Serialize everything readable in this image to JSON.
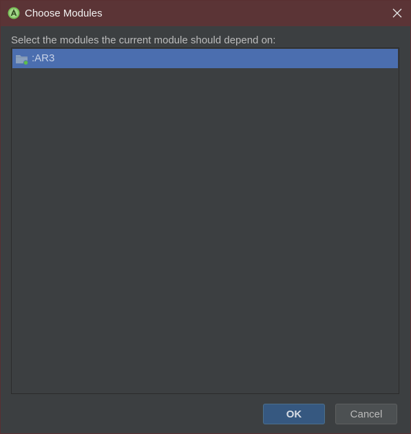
{
  "window": {
    "title": "Choose Modules",
    "app_icon": "android-studio-icon",
    "close_icon": "close-icon"
  },
  "dialog": {
    "prompt": "Select the modules the current module should depend on:",
    "modules": [
      {
        "label": ":AR3",
        "icon": "module-folder-icon",
        "selected": true
      }
    ]
  },
  "buttons": {
    "ok_label": "OK",
    "cancel_label": "Cancel"
  },
  "colors": {
    "titlebar": "#5b3436",
    "background": "#3c3f41",
    "selection": "#4b6eaf",
    "ok_button": "#365880",
    "cancel_button": "#4c5052"
  }
}
